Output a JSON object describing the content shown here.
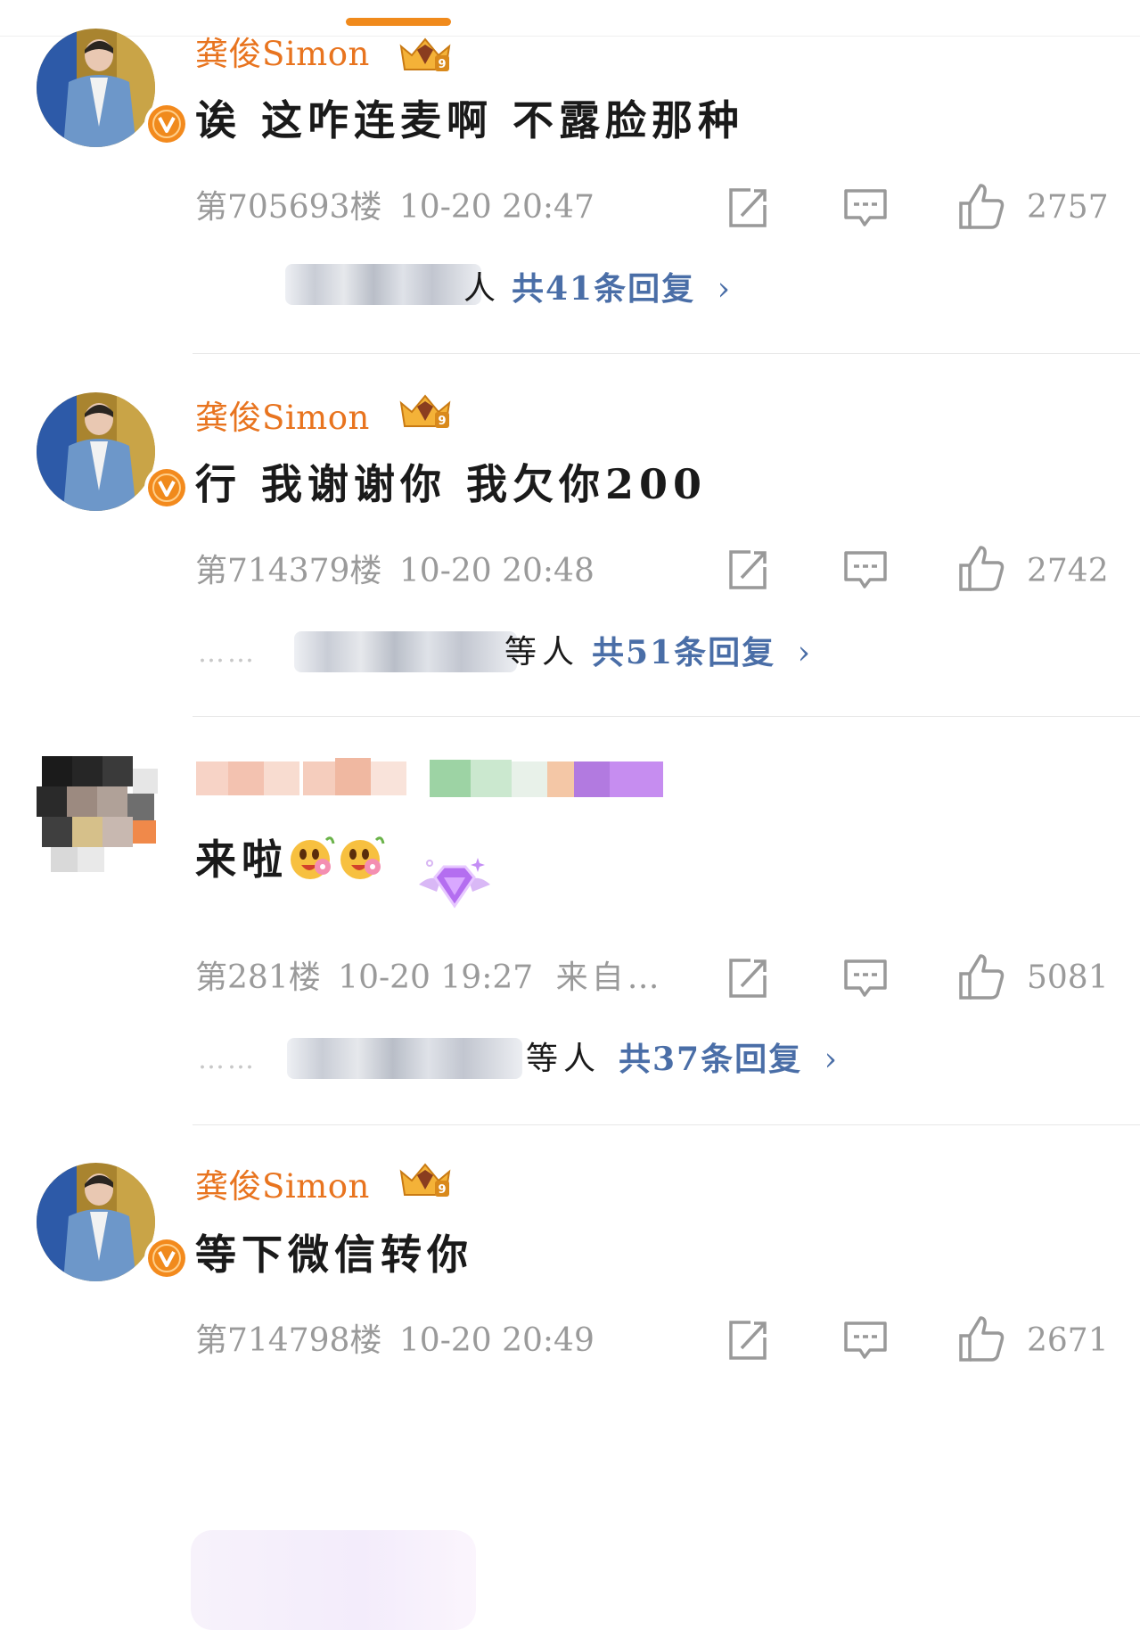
{
  "comments": [
    {
      "username": "龚俊Simon",
      "text": "诶 这咋连麦啊 不露脸那种",
      "floor": "第705693楼",
      "time": "10-20 20:47",
      "likes": "2757",
      "people_suffix": "人",
      "replies": "共41条回复",
      "chevron": "›"
    },
    {
      "username": "龚俊Simon",
      "text": "行 我谢谢你 我欠你200",
      "floor": "第714379楼",
      "time": "10-20 20:48",
      "likes": "2742",
      "dots": "……",
      "people_suffix": "等人",
      "replies": "共51条回复",
      "chevron": "›"
    },
    {
      "text": "来啦",
      "floor": "第281楼",
      "time": "10-20 19:27",
      "source": "来自…",
      "likes": "5081",
      "dots": "……",
      "people_suffix": "等人",
      "replies": "共37条回复",
      "chevron": "›"
    },
    {
      "username": "龚俊Simon",
      "text": "等下微信转你",
      "floor": "第714798楼",
      "time": "10-20 20:49",
      "likes": "2671"
    }
  ],
  "icons": {
    "share": "share-icon",
    "comment": "comment-icon",
    "like": "thumbs-up-icon",
    "verified": "verified-v-badge-icon",
    "crown": "crown-level-icon",
    "emoji": "flower-emoji-icon",
    "diamond": "diamond-badge-icon"
  },
  "colors": {
    "username": "#e8741f",
    "reply_link": "#4a6ea7",
    "meta_text": "#9a9a9a",
    "tab_indicator": "#f08a1c"
  }
}
